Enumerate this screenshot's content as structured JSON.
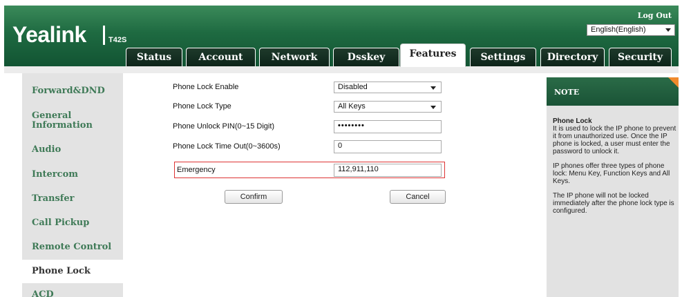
{
  "header": {
    "logo": "Yealink",
    "model": "T42S",
    "logout": "Log Out",
    "language": "English(English)"
  },
  "tabs": [
    {
      "label": "Status"
    },
    {
      "label": "Account"
    },
    {
      "label": "Network"
    },
    {
      "label": "Dsskey"
    },
    {
      "label": "Features"
    },
    {
      "label": "Settings"
    },
    {
      "label": "Directory"
    },
    {
      "label": "Security"
    }
  ],
  "sidebar": {
    "items": [
      {
        "label": "Forward&DND"
      },
      {
        "label": "General"
      },
      {
        "label": "Information"
      },
      {
        "label": "Audio"
      },
      {
        "label": "Intercom"
      },
      {
        "label": "Transfer"
      },
      {
        "label": "Call Pickup"
      },
      {
        "label": "Remote Control"
      },
      {
        "label": "Phone Lock"
      },
      {
        "label": "ACD"
      }
    ]
  },
  "form": {
    "lock_enable_label": "Phone Lock Enable",
    "lock_enable_value": "Disabled",
    "lock_type_label": "Phone Lock Type",
    "lock_type_value": "All Keys",
    "unlock_pin_label": "Phone Unlock PIN(0~15 Digit)",
    "unlock_pin_value": "••••••••",
    "timeout_label": "Phone Lock Time Out(0~3600s)",
    "timeout_value": "0",
    "emergency_label": "Emergency",
    "emergency_value": "112,911,110",
    "confirm_label": "Confirm",
    "cancel_label": "Cancel"
  },
  "note": {
    "title": "NOTE",
    "heading": "Phone Lock",
    "p1": "It is used to lock the IP phone to prevent it from unauthorized use. Once the IP phone is locked, a user must enter the password to unlock it.",
    "p2": "IP phones offer three types of phone lock: Menu Key, Function Keys and All Keys.",
    "p3": "The IP phone will not be locked immediately after the phone lock type is configured."
  },
  "colors": {
    "header_green": "#1e6a41",
    "sidebar_link": "#3f7a57",
    "highlight_red": "#dd3333",
    "note_corner": "#f08a2c"
  }
}
